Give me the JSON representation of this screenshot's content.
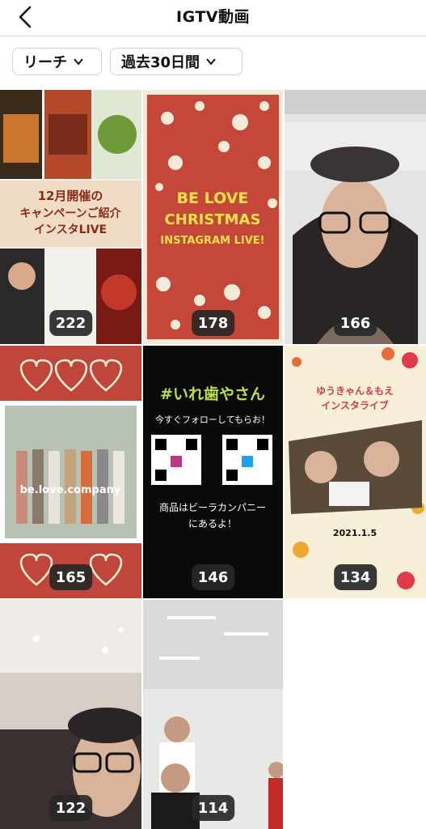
{
  "header": {
    "title": "IGTV動画"
  },
  "filters": {
    "metric": "リーチ",
    "period": "過去30日間"
  },
  "videos": [
    {
      "count": "222",
      "texts": [
        "12月開催の",
        "キャンペーンご紹介",
        "インスタLIVE"
      ]
    },
    {
      "count": "178",
      "texts": [
        "BE LOVE",
        "CHRISTMAS",
        "INSTAGRAM LIVE!"
      ]
    },
    {
      "count": "166"
    },
    {
      "count": "165",
      "texts": [
        "be.love.company"
      ]
    },
    {
      "count": "146",
      "texts": [
        "#いれ歯やさん",
        "今すぐフォローしてもらお！",
        "商品はビーラカンパニー",
        "にあるよ！"
      ]
    },
    {
      "count": "134",
      "texts": [
        "ゆうきゃん＆もえ",
        "インスタライブ",
        "2021.1.5"
      ]
    },
    {
      "count": "122"
    },
    {
      "count": "114"
    }
  ],
  "colors": {
    "red": "#c0463b",
    "cream": "#f7efd8",
    "black": "#0a0a0a"
  }
}
